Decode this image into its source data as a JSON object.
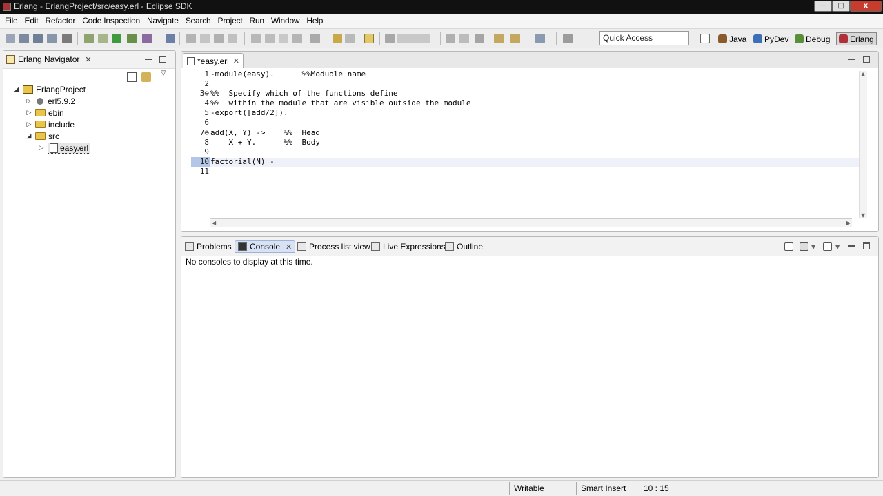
{
  "window": {
    "title": "Erlang - ErlangProject/src/easy.erl - Eclipse SDK",
    "close_glyph": "x"
  },
  "menu": [
    "File",
    "Edit",
    "Refactor",
    "Code Inspection",
    "Navigate",
    "Search",
    "Project",
    "Run",
    "Window",
    "Help"
  ],
  "toolbar": {
    "quick_access_placeholder": "Quick Access",
    "perspectives": [
      {
        "label": "Java",
        "icon": "java-perspective-icon",
        "color": "#8a5a2b"
      },
      {
        "label": "PyDev",
        "icon": "pydev-perspective-icon",
        "color": "#3b6fb6"
      },
      {
        "label": "Debug",
        "icon": "debug-perspective-icon",
        "color": "#5a8f3a"
      },
      {
        "label": "Erlang",
        "icon": "erlang-perspective-icon",
        "color": "#b0303a"
      }
    ]
  },
  "navigator": {
    "title": "Erlang Navigator",
    "tree": [
      {
        "label": "ErlangProject",
        "depth": 0,
        "expanded": true,
        "kind": "project"
      },
      {
        "label": "erl5.9.2",
        "depth": 1,
        "expanded": false,
        "kind": "library"
      },
      {
        "label": "ebin",
        "depth": 1,
        "expanded": false,
        "kind": "folder"
      },
      {
        "label": "include",
        "depth": 1,
        "expanded": false,
        "kind": "folder"
      },
      {
        "label": "src",
        "depth": 1,
        "expanded": true,
        "kind": "folder"
      },
      {
        "label": "easy.erl",
        "depth": 2,
        "expanded": false,
        "kind": "file",
        "selected": true
      }
    ]
  },
  "editor": {
    "tab_label": "*easy.erl",
    "lines": [
      {
        "num": "1",
        "fold": "",
        "text": "-module(easy).      %%Moduole name"
      },
      {
        "num": "2",
        "fold": "",
        "text": ""
      },
      {
        "num": "3",
        "fold": "⊖",
        "text": "%%  Specify which of the functions define"
      },
      {
        "num": "4",
        "fold": "",
        "text": "%%  within the module that are visible outside the module"
      },
      {
        "num": "5",
        "fold": "",
        "text": "-export([add/2])."
      },
      {
        "num": "6",
        "fold": "",
        "text": ""
      },
      {
        "num": "7",
        "fold": "⊖",
        "text": "add(X, Y) ->    %%  Head"
      },
      {
        "num": "8",
        "fold": "",
        "text": "    X + Y.      %%  Body"
      },
      {
        "num": "9",
        "fold": "",
        "text": ""
      },
      {
        "num": "10",
        "fold": "",
        "text": "factorial(N) -"
      },
      {
        "num": "11",
        "fold": "",
        "text": ""
      }
    ],
    "current_line": 10
  },
  "bottom_panel": {
    "tabs": [
      {
        "label": "Problems",
        "icon": "problems-icon",
        "active": false
      },
      {
        "label": "Console",
        "icon": "console-icon",
        "active": true
      },
      {
        "label": "Process list view",
        "icon": "process-list-icon",
        "active": false
      },
      {
        "label": "Live Expressions",
        "icon": "live-expressions-icon",
        "active": false
      },
      {
        "label": "Outline",
        "icon": "outline-icon",
        "active": false
      }
    ],
    "message": "No consoles to display at this time."
  },
  "status": {
    "mode": "Writable",
    "insert": "Smart Insert",
    "position": "10 : 15"
  }
}
